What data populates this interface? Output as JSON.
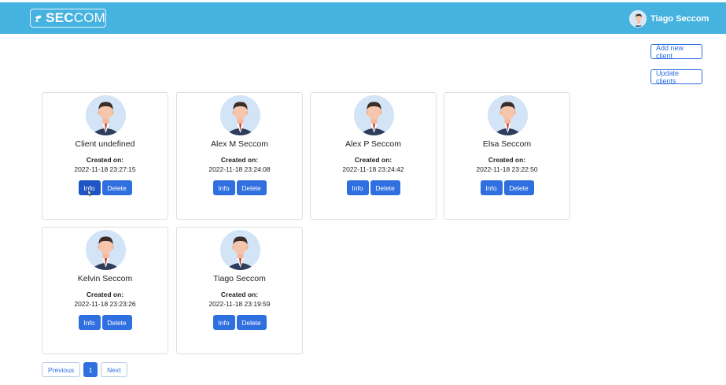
{
  "header": {
    "logo_bold": "SEC",
    "logo_light": "COM",
    "user_name": "Tiago Seccom",
    "background_color": "#45b2e0"
  },
  "actions": {
    "add_client": "Add new client",
    "update_clients": "Update clients"
  },
  "card_labels": {
    "created_on": "Created on:",
    "info": "Info",
    "delete": "Delete"
  },
  "clients": [
    {
      "name": "Client undefined",
      "created": "2022-11-18 23:27:15"
    },
    {
      "name": "Alex M Seccom",
      "created": "2022-11-18 23:24:08"
    },
    {
      "name": "Alex P Seccom",
      "created": "2022-11-18 23:24:42"
    },
    {
      "name": "Elsa Seccom",
      "created": "2022-11-18 23:22:50"
    },
    {
      "name": "Kelvin Seccom",
      "created": "2022-11-18 23:23:26"
    },
    {
      "name": "Tiago Seccom",
      "created": "2022-11-18 23:19:59"
    }
  ],
  "pagination": {
    "previous": "Previous",
    "current": "1",
    "next": "Next"
  },
  "colors": {
    "primary": "#2f6fe0",
    "header": "#45b2e0"
  }
}
